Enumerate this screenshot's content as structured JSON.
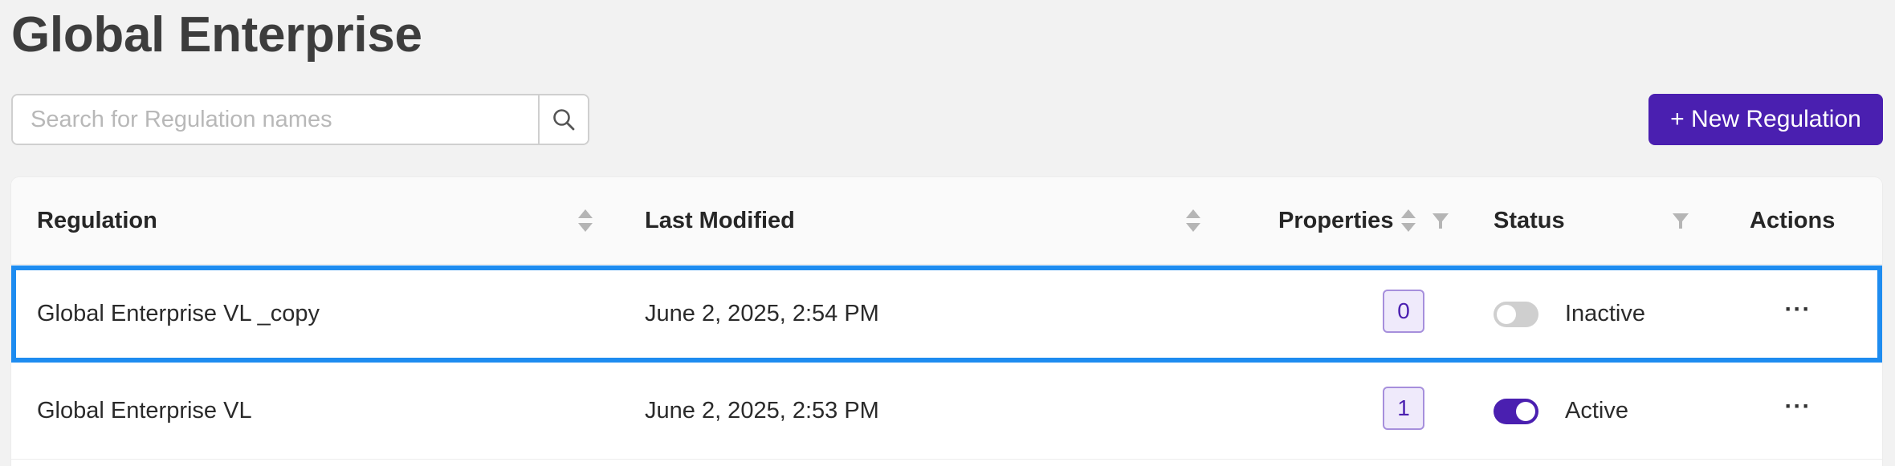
{
  "page": {
    "title": "Global Enterprise"
  },
  "search": {
    "placeholder": "Search for Regulation names",
    "value": ""
  },
  "toolbar": {
    "new_label": "+ New Regulation"
  },
  "table": {
    "columns": {
      "regulation": "Regulation",
      "last_modified": "Last Modified",
      "properties": "Properties",
      "status": "Status",
      "actions": "Actions"
    },
    "rows": [
      {
        "name": "Global Enterprise VL _copy",
        "modified": "June 2, 2025, 2:54 PM",
        "properties": "0",
        "status": "Inactive",
        "active": false,
        "actions": "···",
        "selected": true
      },
      {
        "name": "Global Enterprise VL",
        "modified": "June 2, 2025, 2:53 PM",
        "properties": "1",
        "status": "Active",
        "active": true,
        "actions": "···",
        "selected": false
      }
    ]
  },
  "colors": {
    "accent": "#4a1fb0",
    "selection": "#1e8cf0",
    "toggle_off": "#cfcfcf"
  },
  "icons": {
    "search": "search-icon",
    "sort": "sort-icon",
    "filter": "filter-icon",
    "more": "more-icon"
  }
}
